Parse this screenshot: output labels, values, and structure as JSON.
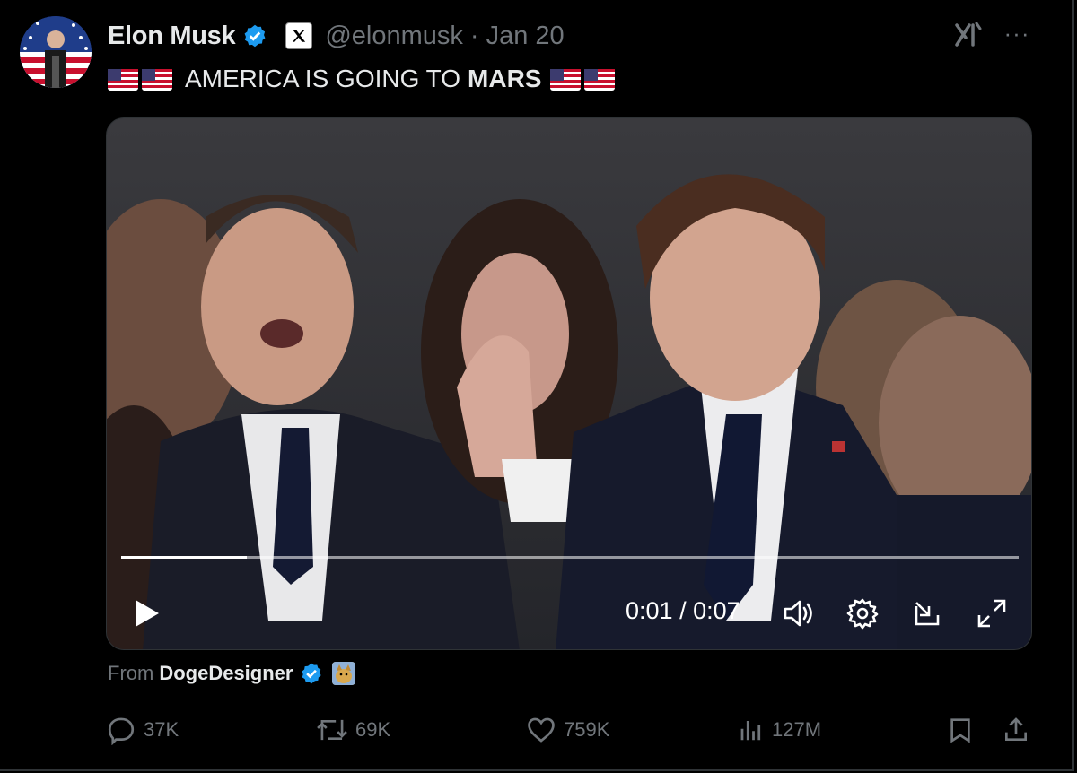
{
  "tweet": {
    "author_name": "Elon Musk",
    "handle": "@elonmusk",
    "separator": "·",
    "date": "Jan 20",
    "text_prefix": "AMERICA IS GOING TO",
    "text_bold": "MARS",
    "more_label": "···"
  },
  "video": {
    "current_time": "0:01",
    "time_separator": "/",
    "duration": "0:07",
    "progress": 0.14
  },
  "attribution": {
    "from_label": "From",
    "source_name": "DogeDesigner"
  },
  "actions": {
    "replies": "37K",
    "reposts": "69K",
    "likes": "759K",
    "views": "127M"
  },
  "colors": {
    "background": "#000000",
    "text": "#e7e9ea",
    "muted": "#71767b",
    "verified": "#1d9bf0"
  },
  "icons": [
    "verified-badge-icon",
    "x-logo-icon",
    "grok-icon",
    "more-icon",
    "play-icon",
    "volume-icon",
    "settings-icon",
    "pip-icon",
    "fullscreen-icon",
    "reply-icon",
    "repost-icon",
    "like-icon",
    "views-icon",
    "bookmark-icon",
    "share-icon",
    "us-flag-icon"
  ]
}
